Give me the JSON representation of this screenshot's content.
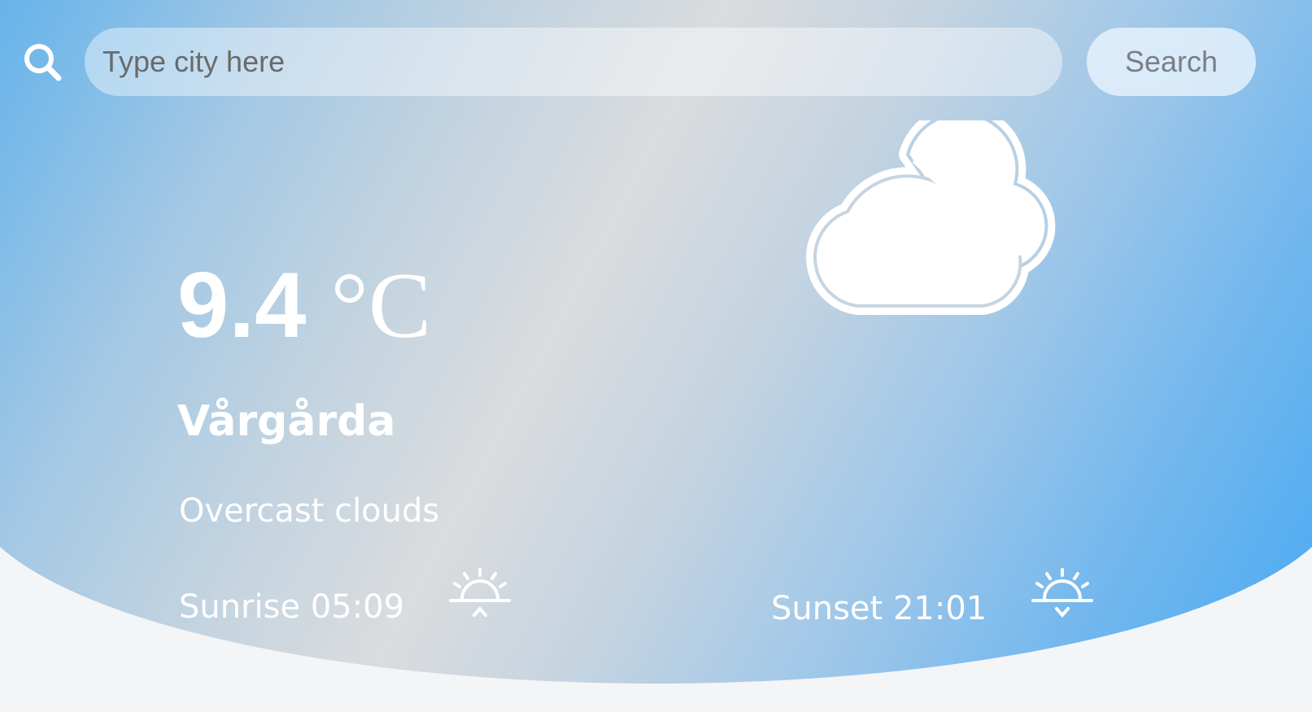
{
  "search": {
    "placeholder": "Type city here",
    "value": "",
    "button_label": "Search",
    "icon": "search-icon"
  },
  "weather": {
    "temperature": "9.4",
    "unit": "°C",
    "city": "Vårgårda",
    "description": "Overcast clouds",
    "sunrise": "Sunrise 05:09",
    "sunset": "Sunset 21:01",
    "condition_icon": "cloud-icon",
    "sunrise_icon": "sunrise-icon",
    "sunset_icon": "sunset-icon"
  },
  "colors": {
    "sky_blue": "#44a8f4",
    "sky_mid": "#a4c8e4",
    "sky_haze": "#dadcde",
    "text": "#ffffff",
    "page_bg": "#f4f5f7"
  }
}
